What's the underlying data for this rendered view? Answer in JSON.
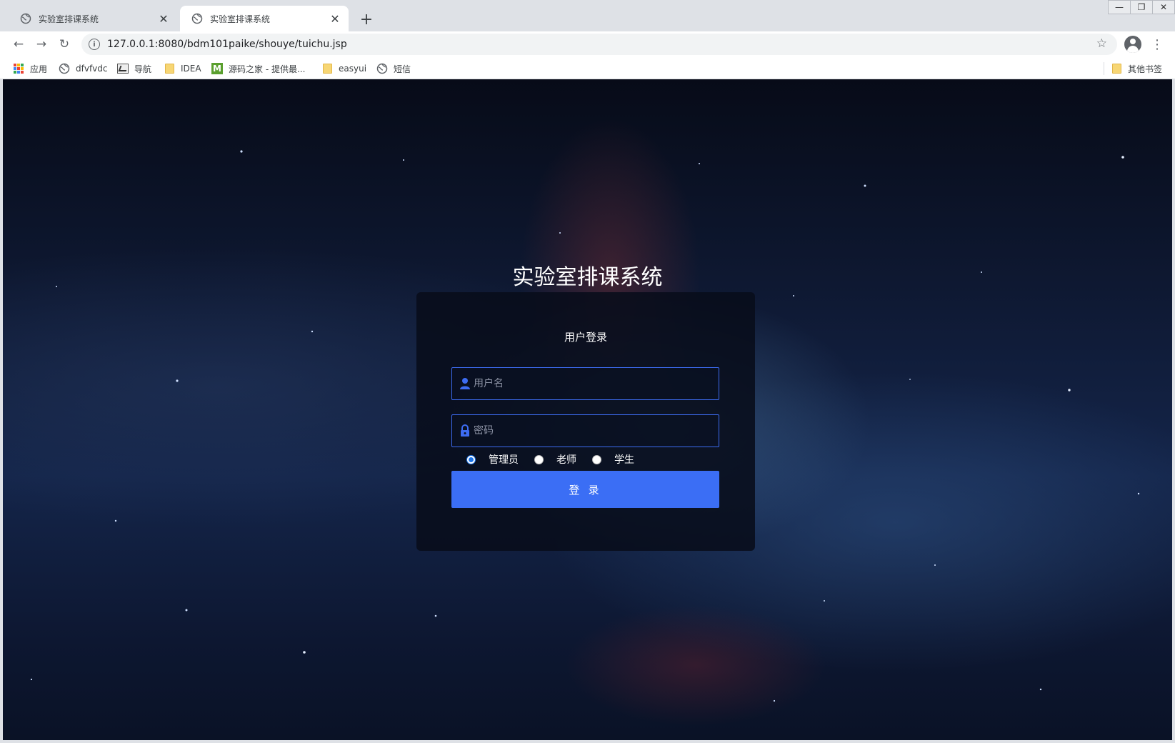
{
  "browser": {
    "tabs": [
      {
        "title": "实验室排课系统",
        "active": false
      },
      {
        "title": "实验室排课系统",
        "active": true
      }
    ],
    "new_tab_icon": "plus-icon",
    "url": "127.0.0.1:8080/bdm101paike/shouye/tuichu.jsp",
    "bookmarks": [
      {
        "label": "应用",
        "icon": "apps-grid-icon"
      },
      {
        "label": "dfvfvdc",
        "icon": "globe-icon"
      },
      {
        "label": "导航",
        "icon": "nav-image-icon"
      },
      {
        "label": "IDEA",
        "icon": "folder-icon"
      },
      {
        "label": "源码之家 - 提供最...",
        "icon": "m-logo-icon"
      },
      {
        "label": "easyui",
        "icon": "folder-icon"
      },
      {
        "label": "短信",
        "icon": "globe-icon"
      }
    ],
    "other_bookmarks": "其他书签"
  },
  "page": {
    "app_title": "实验室排课系统",
    "login": {
      "heading": "用户登录",
      "username_placeholder": "用户名",
      "password_placeholder": "密码",
      "roles": [
        {
          "label": "管理员",
          "checked": true
        },
        {
          "label": "老师",
          "checked": false
        },
        {
          "label": "学生",
          "checked": false
        }
      ],
      "submit_label": "登 录"
    },
    "colors": {
      "accent": "#3b6ef5",
      "field_border": "#3d6cf2",
      "card_bg": "#080c1a"
    }
  }
}
